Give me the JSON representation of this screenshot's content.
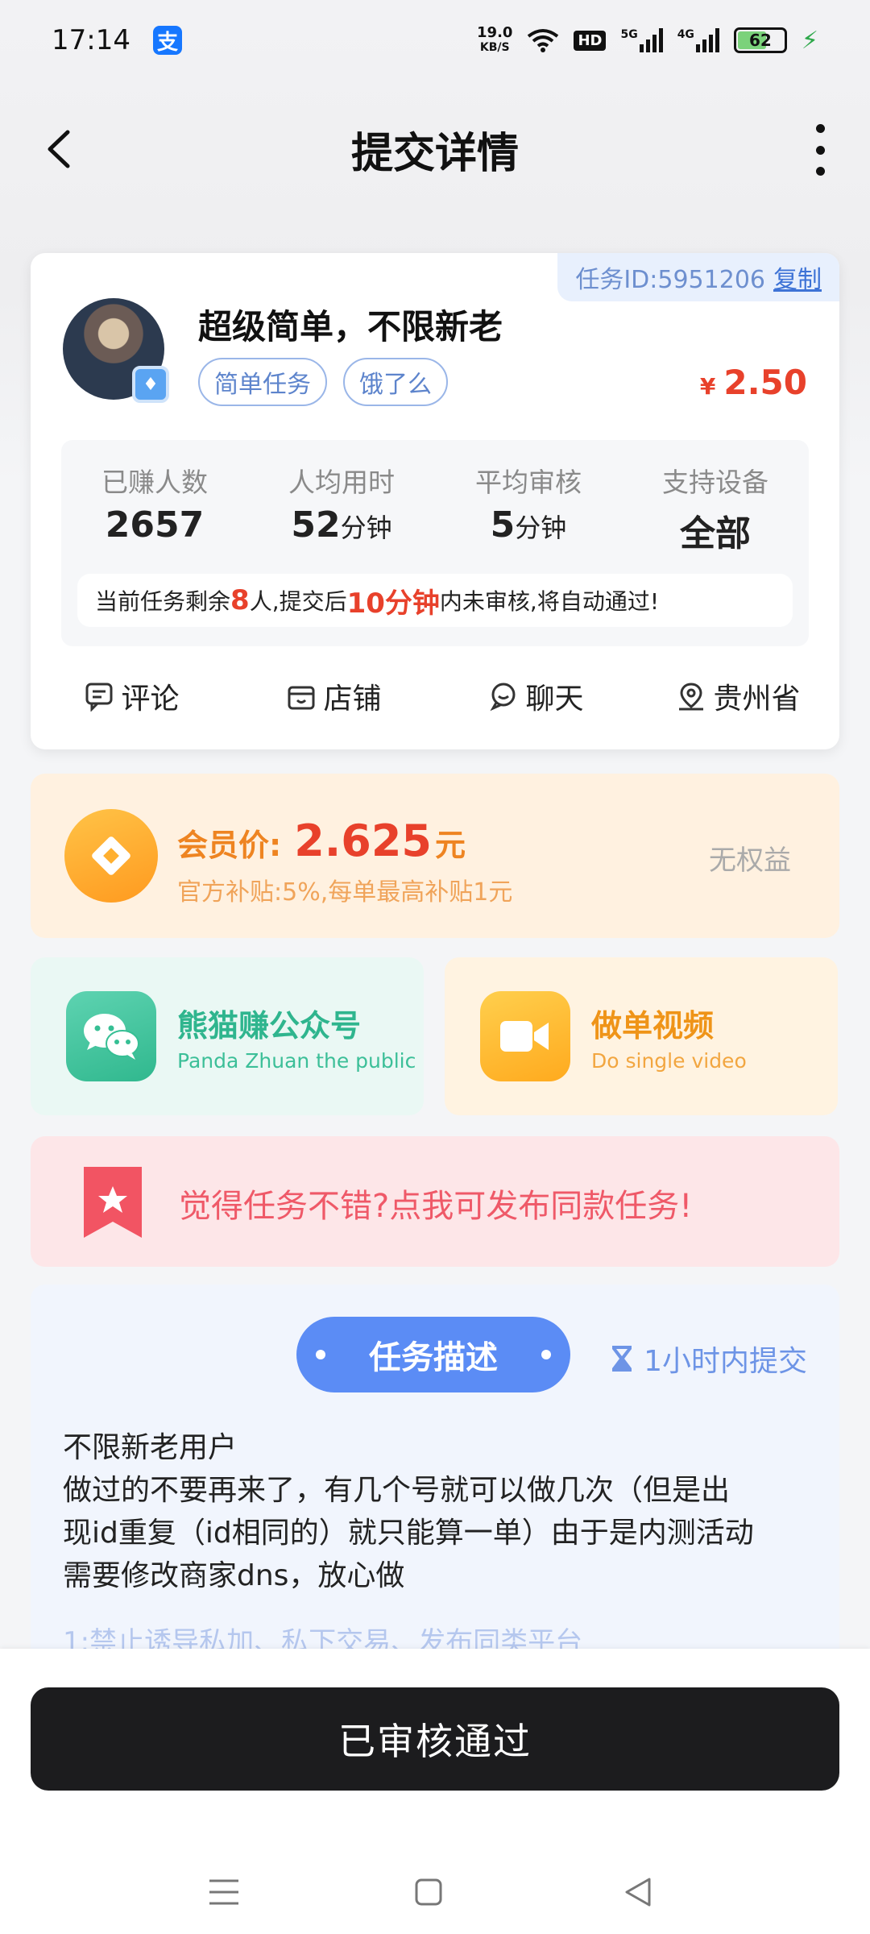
{
  "status_bar": {
    "time": "17:14",
    "alipay_badge": "支",
    "net_speed_value": "19.0",
    "net_speed_unit": "KB/S",
    "hd": "HD",
    "sig1_label": "5G",
    "sig2_label": "4G",
    "battery_level": "62"
  },
  "header": {
    "title": "提交详情"
  },
  "task": {
    "id_label": "任务ID:5951206",
    "copy_label": "复制",
    "title": "超级简单，不限新老",
    "tags": [
      "简单任务",
      "饿了么"
    ],
    "currency": "¥",
    "price": "2.50",
    "stats": [
      {
        "label": "已赚人数",
        "value": "2657",
        "unit": ""
      },
      {
        "label": "人均用时",
        "value": "52",
        "unit": "分钟"
      },
      {
        "label": "平均审核",
        "value": "5",
        "unit": "分钟"
      },
      {
        "label": "支持设备",
        "value": "全部",
        "unit": ""
      }
    ],
    "notice": {
      "p1": "当前任务剩余",
      "remaining": "8",
      "p2": "人,提交后",
      "time": "10分钟",
      "p3": "内未审核,将自动通过!"
    },
    "actions": [
      "评论",
      "店铺",
      "聊天",
      "贵州省"
    ]
  },
  "member": {
    "label": "会员价:",
    "price": "2.625",
    "unit": "元",
    "sub": "官方补贴:5%,每单最高补贴1元",
    "right": "无权益"
  },
  "promos": {
    "wechat": {
      "title": "熊猫赚公众号",
      "sub": "Panda Zhuan the public"
    },
    "video": {
      "title": "做单视频",
      "sub": "Do single video"
    }
  },
  "publish": {
    "text": "觉得任务不错?点我可发布同款任务!"
  },
  "description": {
    "pill": "任务描述",
    "deadline": "1小时内提交",
    "lines": [
      "不限新老用户",
      "做过的不要再来了，有几个号就可以做几次（但是出",
      "现id重复（id相同的）就只能算一单）由于是内测活动",
      "需要修改商家dns，放心做"
    ],
    "rule_partial": "1:禁止诱导私加、私下交易、发布同类平台"
  },
  "bottom": {
    "button": "已审核通过"
  }
}
